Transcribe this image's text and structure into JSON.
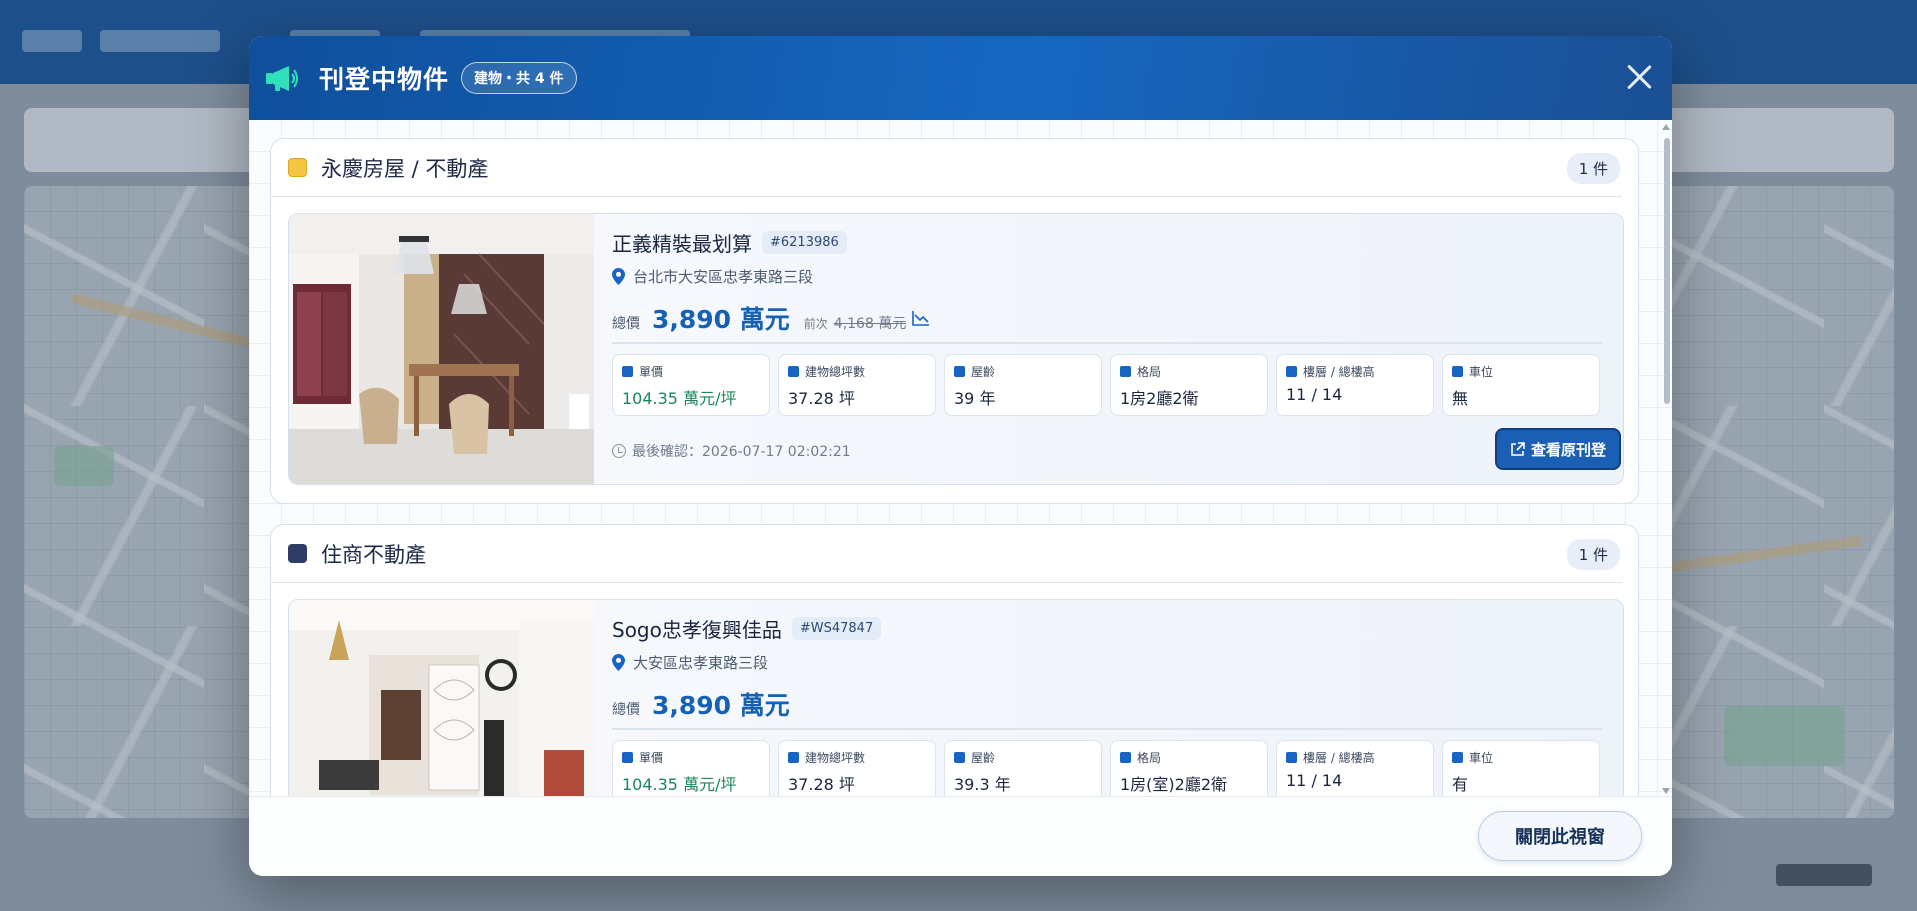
{
  "modal": {
    "title": "刊登中物件",
    "badge": "建物・共 4 件",
    "footer_button": "關閉此視窗"
  },
  "groups": [
    {
      "name": "永慶房屋 / 不動產",
      "color": "#f5c542",
      "count": "1 件",
      "listing": {
        "title": "正義精裝最划算",
        "id": "#6213986",
        "address": "台北市大安區忠孝東路三段",
        "price_label": "總價",
        "price": "3,890 萬元",
        "prev_label": "前次",
        "prev_price": "4,168 萬元",
        "specs": [
          {
            "label": "單價",
            "value": "104.35 萬元/坪",
            "icon": "calculator-icon"
          },
          {
            "label": "建物總坪數",
            "value": "37.28 坪",
            "icon": "area-icon"
          },
          {
            "label": "屋齡",
            "value": "39 年",
            "icon": "hourglass-icon"
          },
          {
            "label": "格局",
            "value": "1房2廳2衛",
            "icon": "grid-icon"
          },
          {
            "label": "樓層 / 總樓高",
            "value": "11 / 14",
            "icon": "layers-icon"
          },
          {
            "label": "車位",
            "value": "無",
            "icon": "car-icon"
          }
        ],
        "confirm": "最後確認：2026-07-17 02:02:21",
        "view_button": "查看原刊登"
      }
    },
    {
      "name": "住商不動產",
      "color": "#2f3d66",
      "count": "1 件",
      "listing": {
        "title": "Sogo忠孝復興佳品",
        "id": "#WS47847",
        "address": "大安區忠孝東路三段",
        "price_label": "總價",
        "price": "3,890 萬元",
        "specs": [
          {
            "label": "單價",
            "value": "104.35 萬元/坪",
            "icon": "calculator-icon"
          },
          {
            "label": "建物總坪數",
            "value": "37.28 坪",
            "icon": "area-icon"
          },
          {
            "label": "屋齡",
            "value": "39.3 年",
            "icon": "hourglass-icon"
          },
          {
            "label": "格局",
            "value": "1房(室)2廳2衛",
            "icon": "grid-icon"
          },
          {
            "label": "樓層 / 總樓高",
            "value": "11 / 14",
            "icon": "layers-icon"
          },
          {
            "label": "車位",
            "value": "有",
            "icon": "car-icon"
          }
        ]
      }
    }
  ],
  "colors": {
    "header": "#1667c0",
    "accent": "#1761b4",
    "unit_price": "#17875a"
  }
}
